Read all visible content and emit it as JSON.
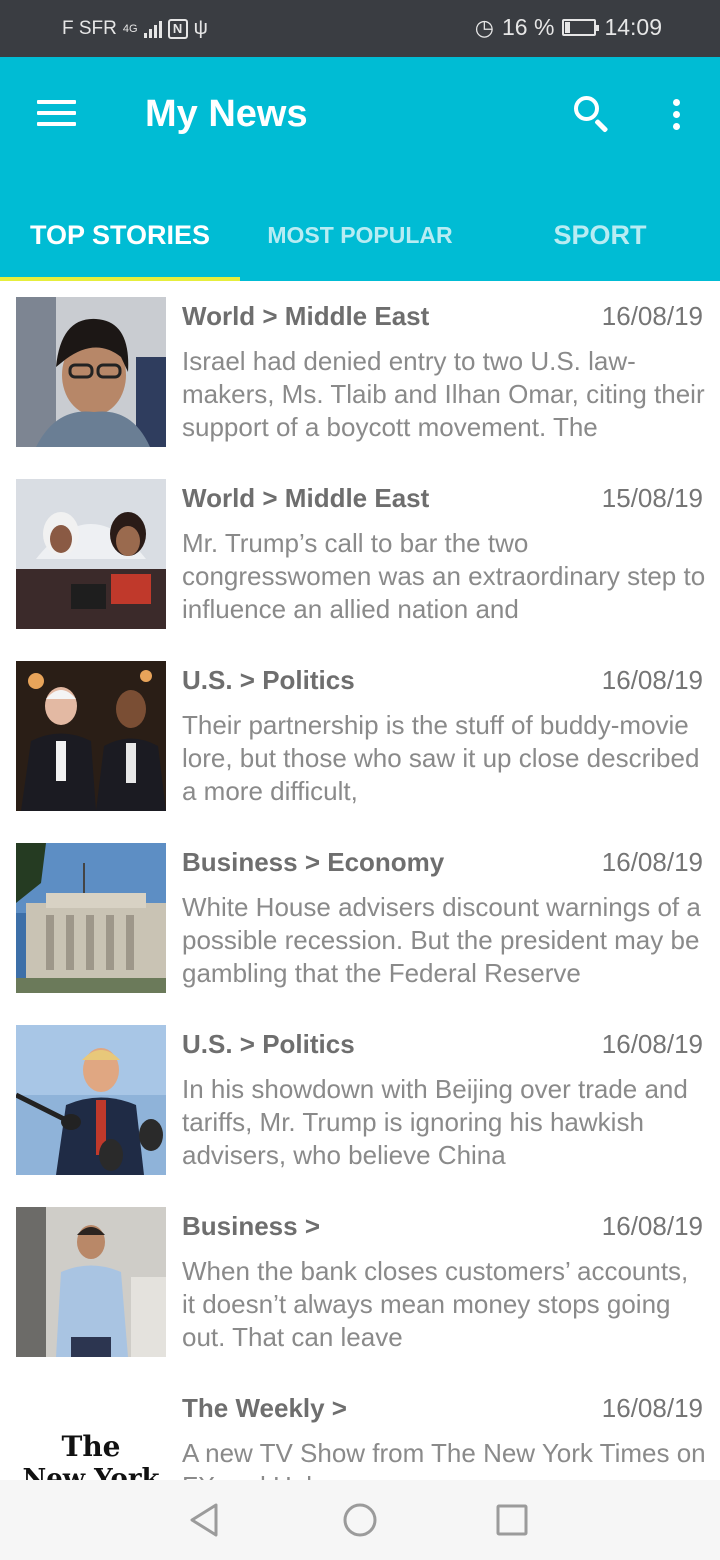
{
  "status_bar": {
    "carrier": "F SFR",
    "network": "4G",
    "battery_percent": "16 %",
    "battery_level": 0.16,
    "time": "14:09"
  },
  "app_bar": {
    "title": "My News",
    "background_color": "#00bcd4",
    "icons": [
      "menu-icon",
      "search-icon",
      "more-vert-icon"
    ]
  },
  "tabs": {
    "items": [
      {
        "label": "TOP STORIES",
        "active": true
      },
      {
        "label": "MOST POPULAR",
        "active": false
      },
      {
        "label": "SPORT",
        "active": false
      }
    ],
    "indicator_color": "#e6ee3c"
  },
  "articles": [
    {
      "section": "World > Middle East",
      "date": "16/08/19",
      "abstract": "Israel had denied entry to two U.S. law­makers, Ms. Tlaib and Ilhan Omar, citing their support of a boycott movement. The"
    },
    {
      "section": "World > Middle East",
      "date": "15/08/19",
      "abstract": "Mr. Trump’s call to bar the two congresswomen was an extraordinary step to influence an allied nation and"
    },
    {
      "section": "U.S. > Politics",
      "date": "16/08/19",
      "abstract": "Their partnership is the stuff of buddy-movie lore, but those who saw it up close described a more difficult,"
    },
    {
      "section": "Business > Economy",
      "date": "16/08/19",
      "abstract": "White House advisers discount warnings of a possible recession. But the president may be gambling that the Federal Reserve"
    },
    {
      "section": "U.S. > Politics",
      "date": "16/08/19",
      "abstract": "In his showdown with Beijing over trade and tariffs, Mr. Trump is ignoring his hawkish advisers, who believe China"
    },
    {
      "section": "Business >",
      "date": "16/08/19",
      "abstract": "When the bank closes customers’ accounts, it doesn’t always mean money stops going out. That can leave"
    },
    {
      "section": "The Weekly >",
      "date": "16/08/19",
      "abstract": "A new TV Show from The New York Times on FX and Hulu"
    }
  ],
  "nyt_logo": [
    "The",
    "New York"
  ],
  "nav_bar": {
    "icons": [
      "back-icon",
      "home-icon",
      "recents-icon"
    ]
  }
}
